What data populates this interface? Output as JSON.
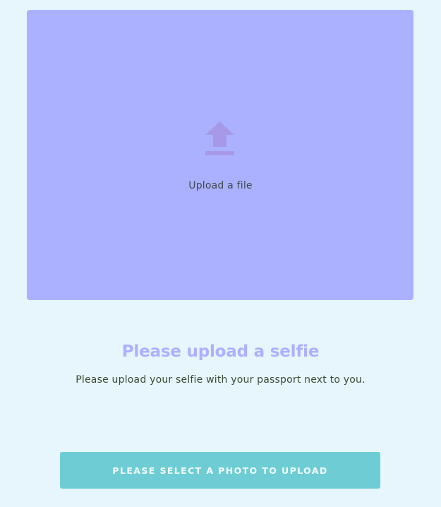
{
  "upload": {
    "label": "Upload a file",
    "icon": "upload-arrow-icon",
    "background_color": "#abb1ff",
    "icon_color": "#a899e8"
  },
  "heading": {
    "title": "Please upload a selfie",
    "subtitle": "Please upload your selfie with your passport next to you."
  },
  "action": {
    "button_label": "PLEASE SELECT A PHOTO TO UPLOAD",
    "button_color": "#6ecdd4"
  },
  "colors": {
    "page_background": "#e6f6fc",
    "title": "#acb0ff"
  }
}
